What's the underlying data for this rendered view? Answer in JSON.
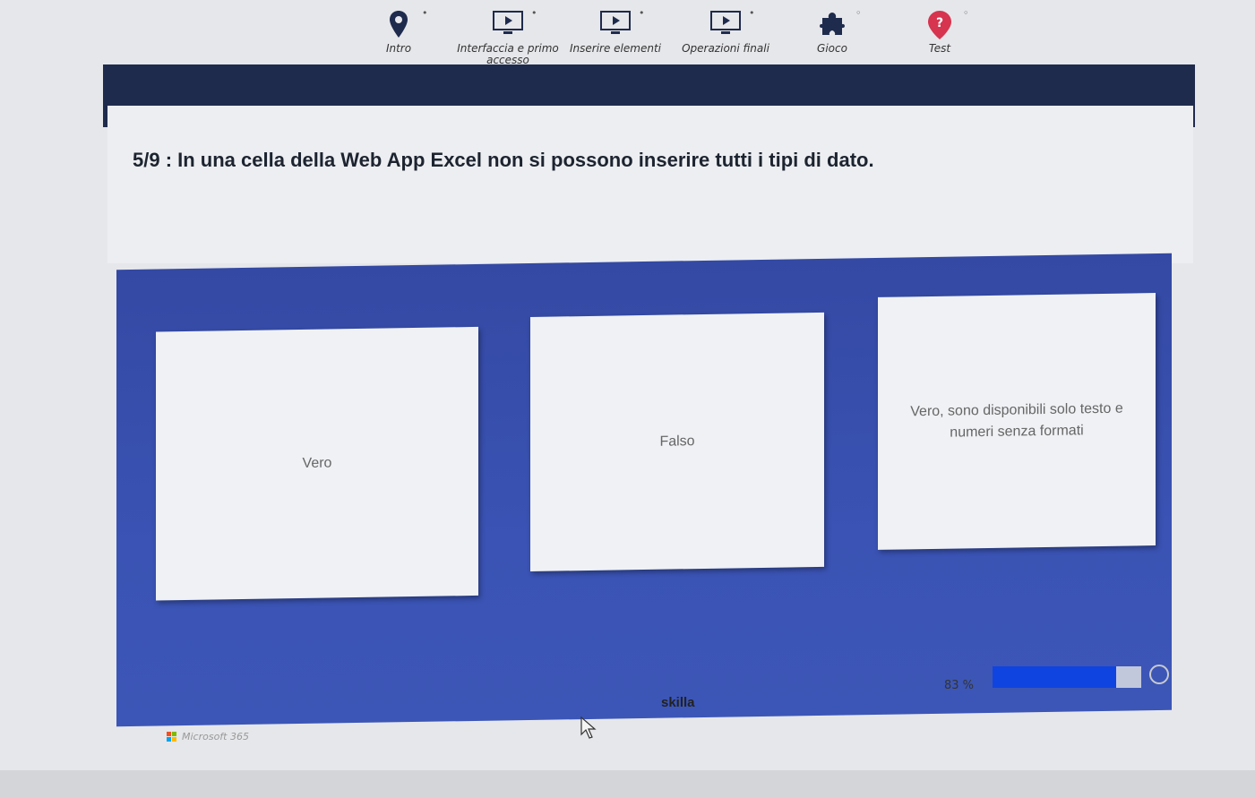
{
  "nav": {
    "items": [
      {
        "label": "Intro",
        "icon": "map-pin-icon"
      },
      {
        "label": "Interfaccia e primo accesso",
        "icon": "play-screen-icon"
      },
      {
        "label": "Inserire elementi",
        "icon": "play-screen-icon"
      },
      {
        "label": "Operazioni finali",
        "icon": "play-screen-icon"
      },
      {
        "label": "Gioco",
        "icon": "puzzle-icon"
      },
      {
        "label": "Test",
        "icon": "question-icon"
      }
    ],
    "active": "Test"
  },
  "question": {
    "text": "5/9 : In una cella della Web App Excel non si possono inserire tutti i tipi di dato."
  },
  "answers": [
    "Vero",
    "Falso",
    "Vero, sono disponibili solo testo e numeri senza formati"
  ],
  "progress": {
    "label": "83 %",
    "value": 83
  },
  "brand": "skilla",
  "footer": {
    "ms_label": "Microsoft 365"
  },
  "colors": {
    "accent": "#d6344f",
    "panel_blue": "#3a53b4",
    "progress_blue": "#1044e0",
    "dark_band": "#1f2b4d"
  }
}
